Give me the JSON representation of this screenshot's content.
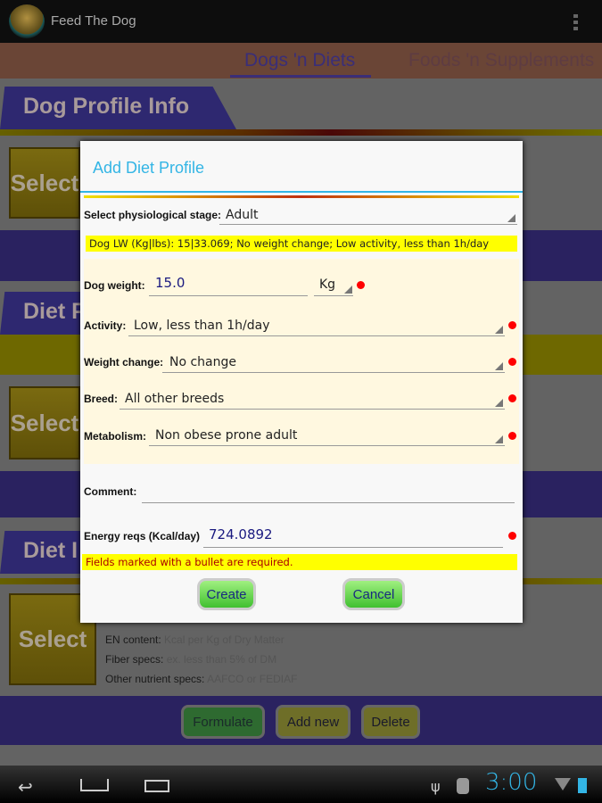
{
  "app": {
    "title": "Feed The Dog"
  },
  "tabs": [
    {
      "label": "Dogs 'n Diets",
      "selected": true
    },
    {
      "label": "Foods 'n Supplements",
      "selected": false
    }
  ],
  "sections": {
    "dog_profile": "Dog Profile Info",
    "diet_profile": "Diet P",
    "diet_info": "Diet I"
  },
  "select_label": "Select",
  "diet_info": {
    "en_label": "EN content:",
    "en_value": "Kcal per Kg of Dry Matter",
    "fiber_label": "Fiber specs:",
    "fiber_value": "ex. less than 5% of DM",
    "other_label": "Other nutrient specs:",
    "other_value": "AAFCO or FEDIAF"
  },
  "bottom_buttons": {
    "formulate": "Formulate",
    "add_new": "Add new",
    "delete": "Delete"
  },
  "dialog": {
    "title": "Add Diet Profile",
    "stage_label": "Select physiological stage:",
    "stage_value": "Adult",
    "summary": "Dog LW (Kg|lbs): 15|33.069; No weight change; Low activity, less than 1h/day",
    "weight_label": "Dog weight:",
    "weight_value": "15.0",
    "unit_value": "Kg",
    "activity_label": "Activity:",
    "activity_value": "Low, less than 1h/day",
    "weight_change_label": "Weight change:",
    "weight_change_value": "No change",
    "breed_label": "Breed:",
    "breed_value": "All other breeds",
    "metabolism_label": "Metabolism:",
    "metabolism_value": "Non obese prone adult",
    "comment_label": "Comment:",
    "comment_value": "",
    "energy_label": "Energy reqs (Kcal/day)",
    "energy_value": "724.0892",
    "note": "Fields marked with a bullet are required.",
    "create": "Create",
    "cancel": "Cancel"
  },
  "status": {
    "time": "3:00"
  },
  "colors": {
    "accent": "#33b5e5",
    "required": "#ff0000",
    "brand_purple": "#3a2e90"
  }
}
